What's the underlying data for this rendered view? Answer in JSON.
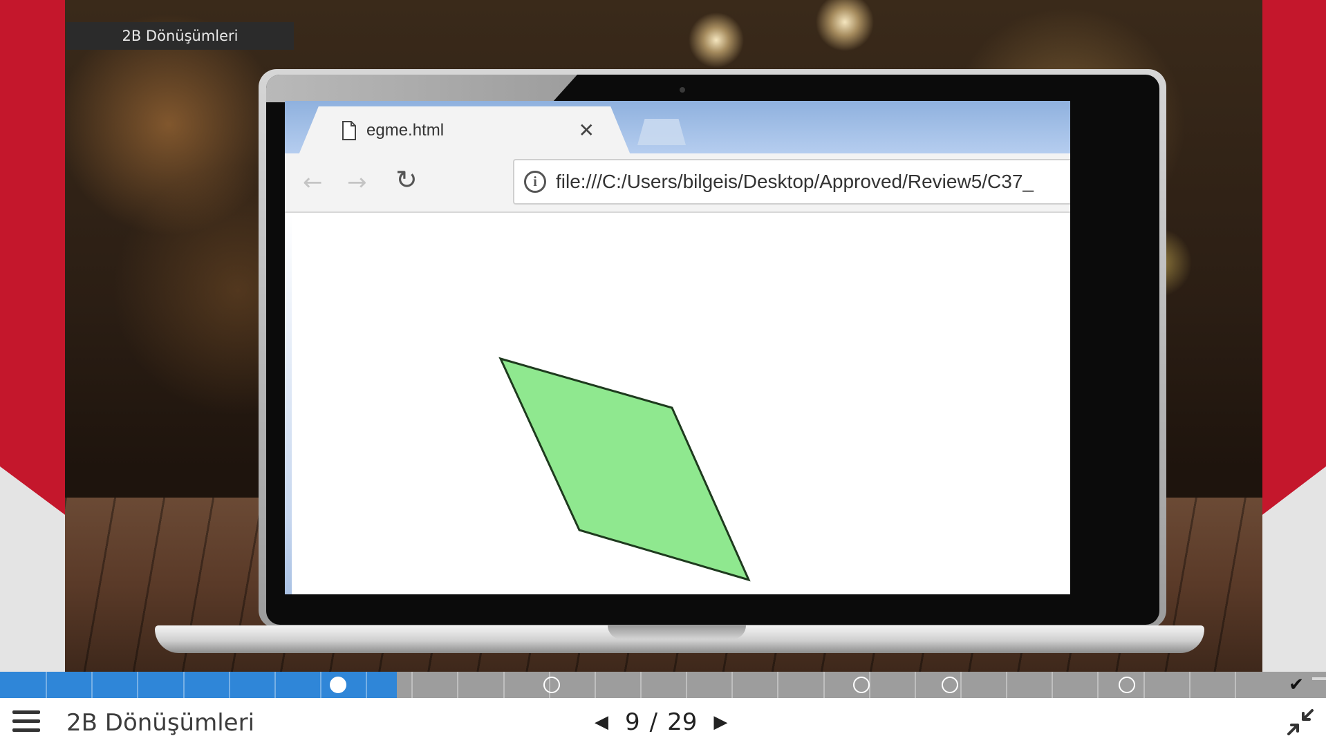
{
  "video": {
    "chip_title": "2B Dönüşümleri",
    "browser": {
      "tab_title": "egme.html",
      "url": "file:///C:/Users/bilgeis/Desktop/Approved/Review5/C37_"
    }
  },
  "player": {
    "progress": 0.31,
    "segments": 28,
    "markers": [
      {
        "position": 0.264,
        "state": "current"
      },
      {
        "position": 0.431,
        "state": "unvisited"
      },
      {
        "position": 0.673,
        "state": "unvisited"
      },
      {
        "position": 0.742,
        "state": "unvisited"
      },
      {
        "position": 0.88,
        "state": "unvisited"
      }
    ],
    "course_title": "2B Dönüşümleri",
    "current_page": "9",
    "separator": "/",
    "total_pages": "29"
  },
  "colors": {
    "brand_red": "#c4172c",
    "progress_blue": "#2f86d8",
    "shape_green": "#8fe88f"
  },
  "icons": {
    "menu": "hamburger-icon",
    "prev": "caret-left-icon",
    "next": "caret-right-icon",
    "exit": "exit-fullscreen-icon",
    "complete": "checkmark-icon"
  }
}
